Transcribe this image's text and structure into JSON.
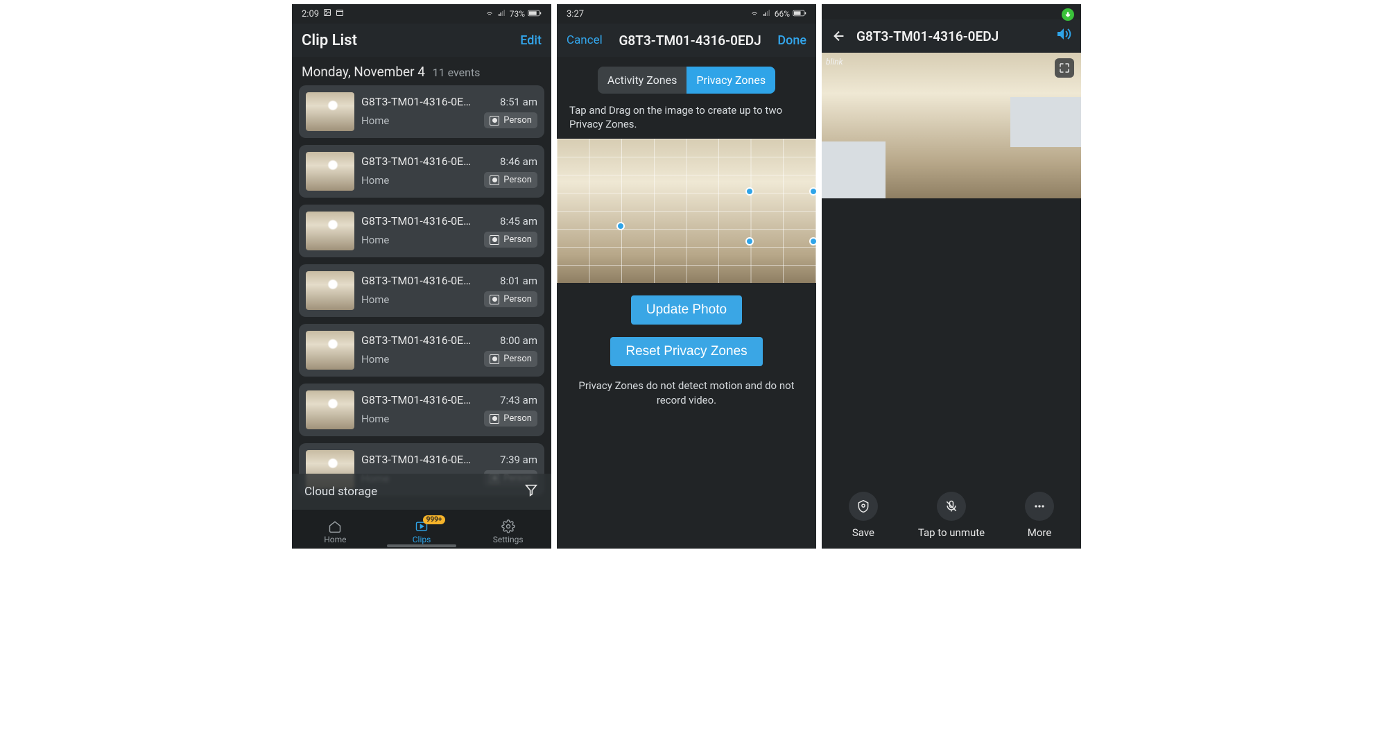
{
  "screen1": {
    "status": {
      "time": "2:09",
      "battery": "73%"
    },
    "title": "Clip List",
    "edit": "Edit",
    "date": "Monday, November 4",
    "event_count": "11 events",
    "clips": [
      {
        "name": "G8T3-TM01-4316-0E…",
        "time": "8:51 am",
        "location": "Home",
        "badge": "Person"
      },
      {
        "name": "G8T3-TM01-4316-0E…",
        "time": "8:46 am",
        "location": "Home",
        "badge": "Person"
      },
      {
        "name": "G8T3-TM01-4316-0E…",
        "time": "8:45 am",
        "location": "Home",
        "badge": "Person"
      },
      {
        "name": "G8T3-TM01-4316-0E…",
        "time": "8:01 am",
        "location": "Home",
        "badge": "Person"
      },
      {
        "name": "G8T3-TM01-4316-0E…",
        "time": "8:00 am",
        "location": "Home",
        "badge": "Person"
      },
      {
        "name": "G8T3-TM01-4316-0E…",
        "time": "7:43 am",
        "location": "Home",
        "badge": "Person"
      },
      {
        "name": "G8T3-TM01-4316-0E…",
        "time": "7:39 am",
        "location": "Home",
        "badge": "Person"
      }
    ],
    "cloud": "Cloud storage",
    "tabs": {
      "home": "Home",
      "clips": "Clips",
      "settings": "Settings",
      "badge": "999+"
    }
  },
  "screen2": {
    "status": {
      "time": "3:27",
      "battery": "66%"
    },
    "cancel": "Cancel",
    "device": "G8T3-TM01-4316-0EDJ",
    "done": "Done",
    "seg_activity": "Activity Zones",
    "seg_privacy": "Privacy Zones",
    "instruction": "Tap and Drag on the image to create up to two Privacy Zones.",
    "update_btn": "Update Photo",
    "reset_btn": "Reset Privacy Zones",
    "footnote": "Privacy Zones do not detect motion and do not record video."
  },
  "screen3": {
    "device": "G8T3-TM01-4316-0EDJ",
    "watermark": "blink",
    "tools": {
      "save": "Save",
      "unmute": "Tap to unmute",
      "more": "More"
    }
  }
}
